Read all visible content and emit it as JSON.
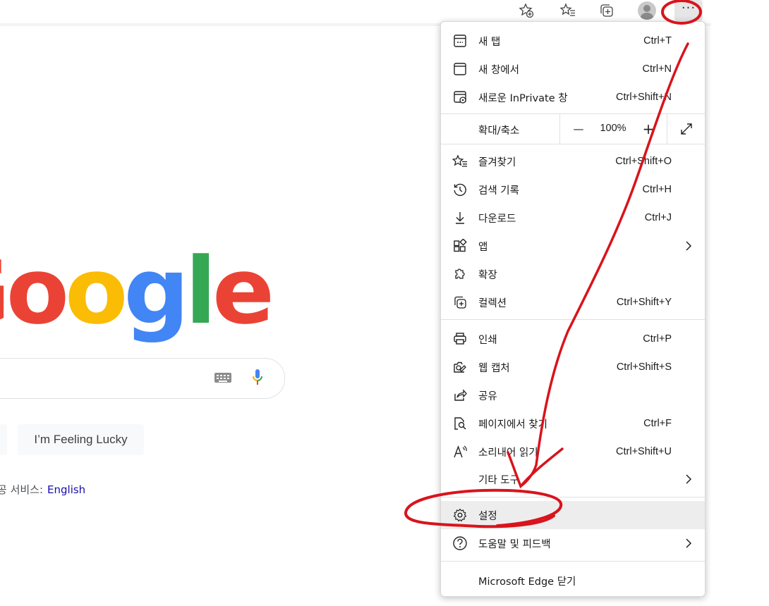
{
  "browser": {
    "toolbar_icons": [
      "favorite-add-icon",
      "favorites-icon",
      "collections-icon",
      "profile-avatar",
      "settings-and-more-icon"
    ],
    "more_button_label": "···"
  },
  "page": {
    "logo_letters": [
      "o",
      "o",
      "g",
      "l",
      "e"
    ],
    "logo_colors": [
      "#fbbc05",
      "#fbbc05",
      "#4285f4",
      "#34a853",
      "#ea4335"
    ],
    "lucky_button": "I’m Feeling Lucky",
    "offer_prefix": "공 서비스:",
    "offer_link": "English"
  },
  "menu": {
    "new_tab": {
      "label": "새 탭",
      "shortcut": "Ctrl+T",
      "icon": "new-tab-icon"
    },
    "new_window": {
      "label": "새 창에서",
      "shortcut": "Ctrl+N",
      "icon": "new-window-icon"
    },
    "inprivate": {
      "label": "새로운 InPrivate 창",
      "shortcut": "Ctrl+Shift+N",
      "icon": "inprivate-icon"
    },
    "zoom": {
      "label": "확대/축소",
      "minus": "—",
      "value": "100%",
      "plus": "+"
    },
    "favorites": {
      "label": "즐겨찾기",
      "shortcut": "Ctrl+Shift+O",
      "icon": "favorites-icon"
    },
    "history": {
      "label": "검색 기록",
      "shortcut": "Ctrl+H",
      "icon": "history-icon"
    },
    "downloads": {
      "label": "다운로드",
      "shortcut": "Ctrl+J",
      "icon": "download-icon"
    },
    "apps": {
      "label": "앱",
      "icon": "apps-icon"
    },
    "extensions": {
      "label": "확장",
      "icon": "extensions-icon"
    },
    "collections": {
      "label": "컬렉션",
      "shortcut": "Ctrl+Shift+Y",
      "icon": "collections-icon"
    },
    "print": {
      "label": "인쇄",
      "shortcut": "Ctrl+P",
      "icon": "print-icon"
    },
    "web_capture": {
      "label": "웹 캡처",
      "shortcut": "Ctrl+Shift+S",
      "icon": "web-capture-icon"
    },
    "share": {
      "label": "공유",
      "icon": "share-icon"
    },
    "find": {
      "label": "페이지에서 찾기",
      "shortcut": "Ctrl+F",
      "icon": "find-icon"
    },
    "read_aloud": {
      "label": "소리내어 읽기",
      "shortcut": "Ctrl+Shift+U",
      "icon": "read-aloud-icon"
    },
    "more_tools": {
      "label": "기타 도구"
    },
    "settings": {
      "label": "설정",
      "icon": "settings-icon"
    },
    "help": {
      "label": "도움말 및 피드백",
      "icon": "help-icon"
    },
    "close_edge": {
      "label": "Microsoft Edge 닫기"
    }
  },
  "annotation": {
    "color": "#d8141c"
  }
}
